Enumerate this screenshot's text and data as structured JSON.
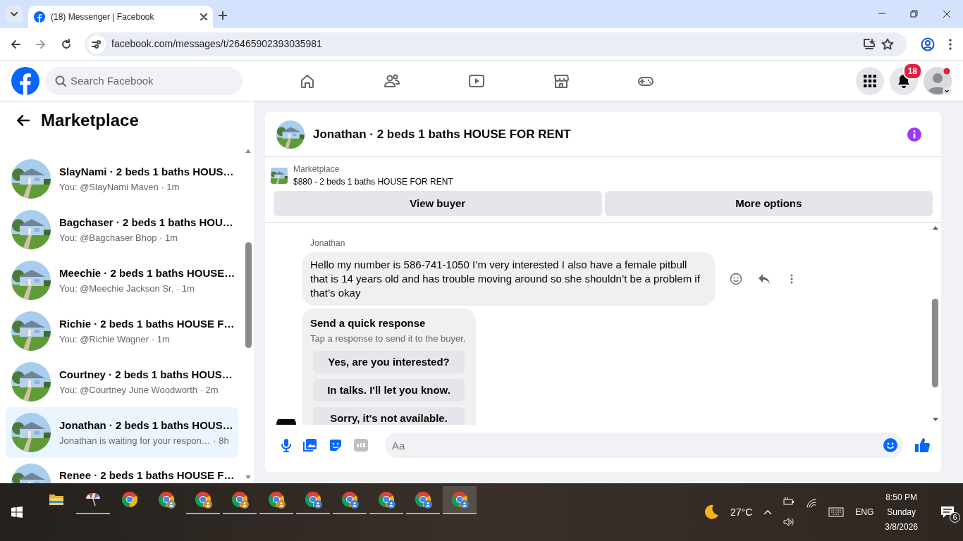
{
  "browser": {
    "tabs": [
      {
        "title": "(18) Messenger | Facebook",
        "selected": true
      }
    ],
    "url": "facebook.com/messages/t/26465902393035981"
  },
  "header": {
    "search_placeholder": "Search Facebook",
    "notification_count": "18"
  },
  "sidebar": {
    "title": "Marketplace",
    "conversations": [
      {
        "title": "SlayNami · 2 beds 1 baths HOUS…",
        "subtitle": "You: @SlayNami Maven · 1m",
        "selected": false
      },
      {
        "title": "Bagchaser · 2 beds 1 baths HOU…",
        "subtitle": "You: @Bagchaser Bhop · 1m",
        "selected": false
      },
      {
        "title": "Meechie · 2 beds 1 baths HOUSE…",
        "subtitle": "You: @Meechie Jackson Sr. · 1m",
        "selected": false
      },
      {
        "title": "Richie · 2 beds 1 baths HOUSE F…",
        "subtitle": "You: @Richie Wagner · 1m",
        "selected": false
      },
      {
        "title": "Courtney · 2 beds 1 baths HOUS…",
        "subtitle": "You: @Courtney June Woodworth · 2m",
        "selected": false
      },
      {
        "title": "Jonathan · 2 beds 1 baths HOUS…",
        "subtitle": "Jonathan is waiting for your respon… · 8h",
        "selected": true
      },
      {
        "title": "Renee · 2 beds 1 baths HOUSE F…",
        "selected": false
      }
    ]
  },
  "chat": {
    "title": "Jonathan · 2 beds 1 baths HOUSE FOR RENT",
    "listing": {
      "label": "Marketplace",
      "name": "$880 - 2 beds 1 baths HOUSE FOR RENT"
    },
    "buttons": [
      "View buyer",
      "More options"
    ],
    "sender": "Jonathan",
    "message": "Hello my number is 586-741-1050 I’m very interested I also have a female pitbull that is 14 years old and has trouble moving around so she shouldn’t be a problem if that’s okay",
    "quick_response": {
      "title": "Send a quick response",
      "hint": "Tap a response to send it to the buyer.",
      "options": [
        "Yes, are you interested?",
        "In talks. I'll let you know.",
        "Sorry, it's not available."
      ]
    },
    "composer": {
      "placeholder": "Aa"
    }
  },
  "taskbar": {
    "apps": [
      {
        "kind": "explorer",
        "running": false,
        "selected": false
      },
      {
        "kind": "umbrella",
        "running": true,
        "selected": false
      },
      {
        "kind": "chrome",
        "running": false,
        "selected": false
      },
      {
        "kind": "chrome",
        "color": "#8a8a8a",
        "running": false,
        "selected": false
      },
      {
        "kind": "chrome",
        "color": "#c9893b",
        "running": true,
        "selected": false
      },
      {
        "kind": "chrome",
        "color": "#c9893b",
        "running": true,
        "selected": false
      },
      {
        "kind": "chrome",
        "color": "#c9893b",
        "running": true,
        "selected": false
      },
      {
        "kind": "chrome",
        "color": "#3b7ed6",
        "running": true,
        "selected": false
      },
      {
        "kind": "chrome",
        "color": "#3b7ed6",
        "running": true,
        "selected": false
      },
      {
        "kind": "chrome",
        "color": "#3b7ed6",
        "running": true,
        "selected": false
      },
      {
        "kind": "chrome",
        "color": "#3b7ed6",
        "running": true,
        "selected": false
      },
      {
        "kind": "chrome",
        "color": "#3b7ed6",
        "running": true,
        "selected": true
      }
    ],
    "temperature": "27°C",
    "language": "ENG",
    "time": "8:50 PM",
    "day": "Sunday",
    "date": "3/8/2026",
    "notification_count": "6"
  }
}
